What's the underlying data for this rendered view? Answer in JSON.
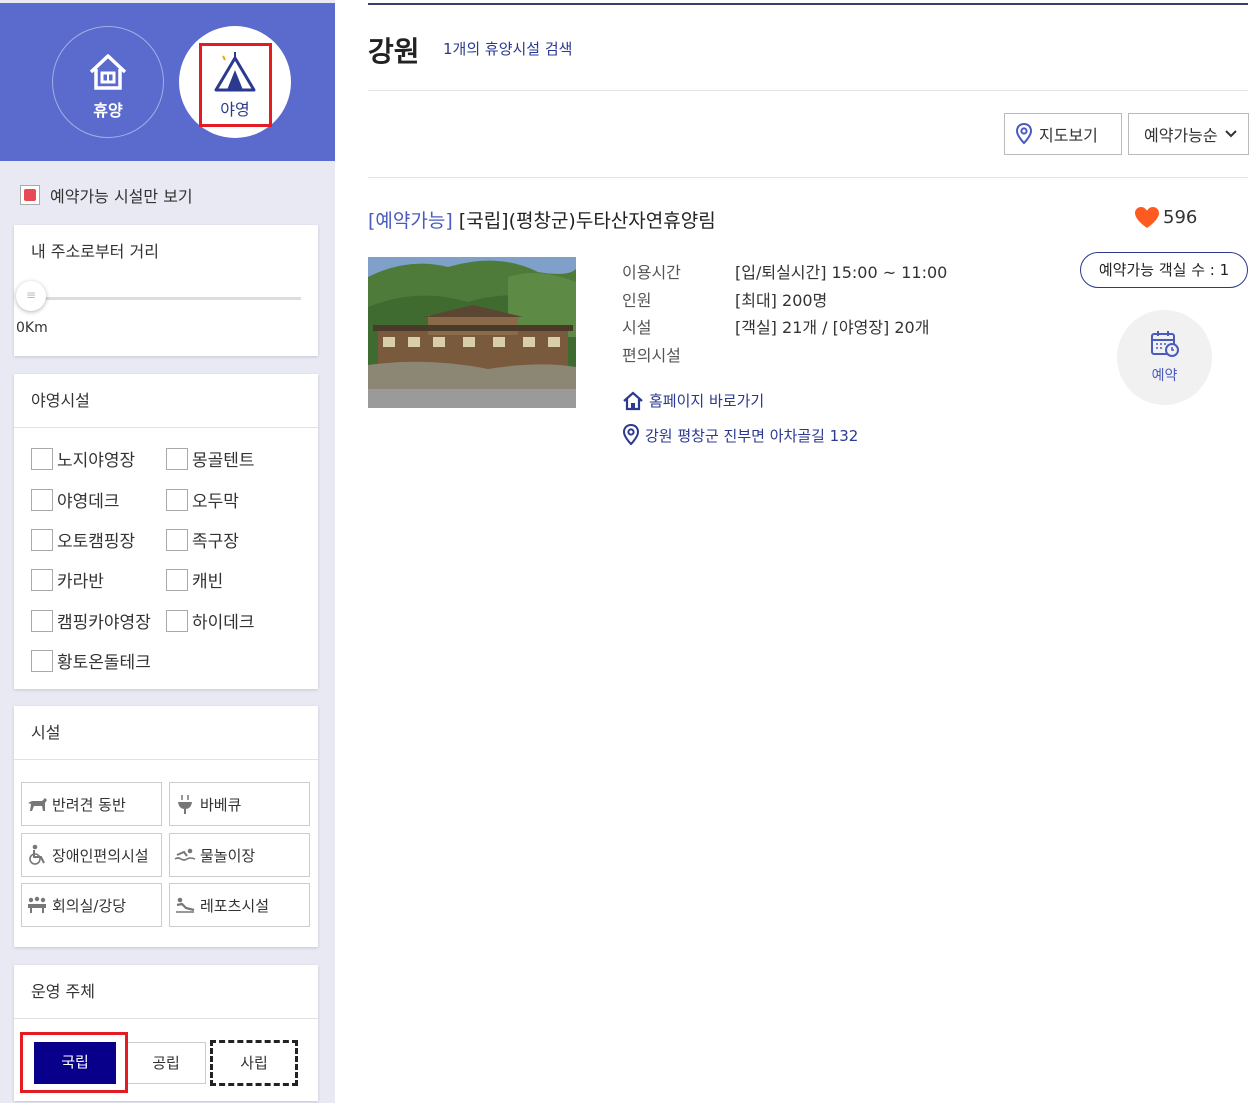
{
  "facility_type": {
    "stay_label": "휴양",
    "camp_label": "야영"
  },
  "filters": {
    "only_available_label": "예약가능 시설만 보기",
    "distance": {
      "title": "내 주소로부터 거리",
      "value_text": "0Km",
      "handle_glyph": "≡"
    },
    "camping": {
      "title": "야영시설",
      "items": [
        "노지야영장",
        "몽골텐트",
        "야영데크",
        "오두막",
        "오토캠핑장",
        "족구장",
        "카라반",
        "캐빈",
        "캠핑카야영장",
        "하이데크",
        "황토온돌테크"
      ]
    },
    "facilities": {
      "title": "시설",
      "items": [
        {
          "label": "반려견 동반",
          "icon": "dog-icon"
        },
        {
          "label": "바베큐",
          "icon": "grill-icon"
        },
        {
          "label": "장애인편의시설",
          "icon": "wheelchair-icon"
        },
        {
          "label": "물놀이장",
          "icon": "swimming-icon"
        },
        {
          "label": "회의실/강당",
          "icon": "meeting-icon"
        },
        {
          "label": "레포츠시설",
          "icon": "leisure-sports-icon"
        }
      ]
    },
    "operator": {
      "title": "운영 주체",
      "national": "국립",
      "public": "공립",
      "private": "사립"
    }
  },
  "results": {
    "region": "강원",
    "count_text": "1개의 휴양시설 검색",
    "map_button": "지도보기",
    "sort_label": "예약가능순",
    "item": {
      "status": "[예약가능]",
      "name": "[국립](평창군)두타산자연휴양림",
      "likes": "596",
      "rows": [
        {
          "label": "이용시간",
          "value": "[입/퇴실시간] 15:00 ~ 11:00"
        },
        {
          "label": "인원",
          "value": "[최대] 200명"
        },
        {
          "label": "시설",
          "value": "[객실] 21개 / [야영장] 20개"
        },
        {
          "label": "편의시설",
          "value": ""
        }
      ],
      "homepage_link": "홈페이지 바로가기",
      "address": "강원 평창군 진부면 아차골길 132",
      "rooms_available": "예약가능 객실 수 : 1",
      "reserve_label": "예약"
    }
  },
  "colors": {
    "brand_blue": "#5a6acd",
    "navy": "#08008a",
    "accent_text": "#2b3990",
    "highlight_red": "#e31b23",
    "heart": "#ff5a1f"
  }
}
